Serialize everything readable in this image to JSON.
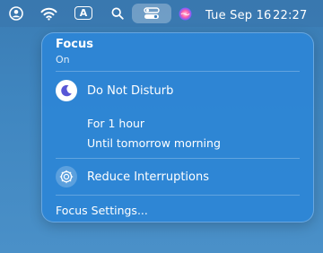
{
  "menubar": {
    "icons": [
      "user-circle-icon",
      "wifi-icon",
      "input-source-icon",
      "search-icon",
      "control-center-icon",
      "siri-icon"
    ],
    "input_source_label": "A",
    "date": "Tue Sep 16",
    "time": "22:27"
  },
  "focus": {
    "title": "Focus",
    "status": "On",
    "dnd_label": "Do Not Disturb",
    "options": [
      "For 1 hour",
      "Until tomorrow morning"
    ],
    "reduce_label": "Reduce Interruptions",
    "settings_label": "Focus Settings..."
  },
  "colors": {
    "panel": "#2c85d6",
    "moon": "#5856d6"
  }
}
